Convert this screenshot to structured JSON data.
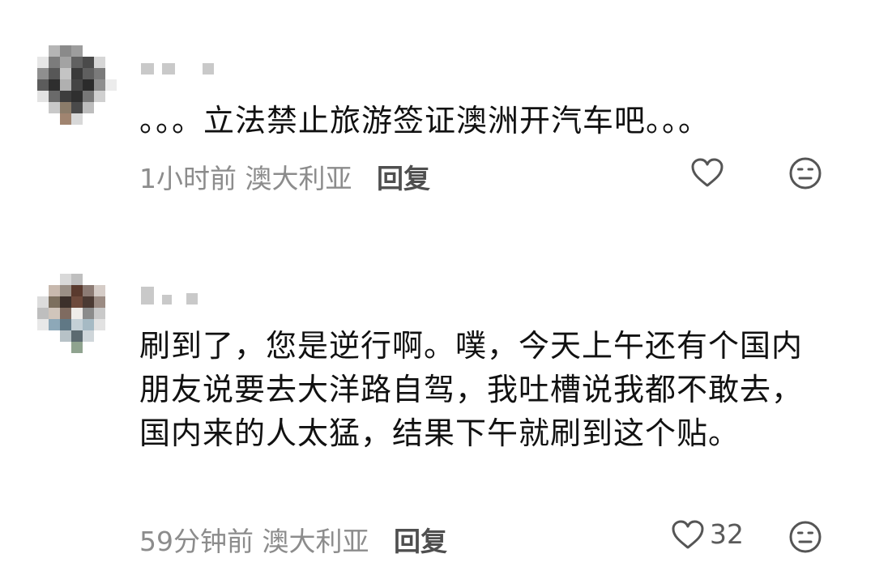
{
  "comments": [
    {
      "text": "。。。立法禁止旅游签证澳洲开汽车吧。。。",
      "time": "1小时前",
      "location": "澳大利亚",
      "reply_label": "回复",
      "like_count": ""
    },
    {
      "text": "刷到了，您是逆行啊。噗，今天上午还有个国内朋友说要去大洋路自驾，我吐槽说我都不敢去，国内来的人太猛，结果下午就刷到这个贴。",
      "time": "59分钟前",
      "location": "澳大利亚",
      "reply_label": "回复",
      "like_count": "32"
    }
  ],
  "icons": {
    "like": "heart-outline-icon",
    "dislike": "neutral-face-icon"
  },
  "colors": {
    "text": "#111111",
    "meta": "#8c8c8c",
    "reply": "#4f4f4f",
    "icon": "#555555"
  }
}
